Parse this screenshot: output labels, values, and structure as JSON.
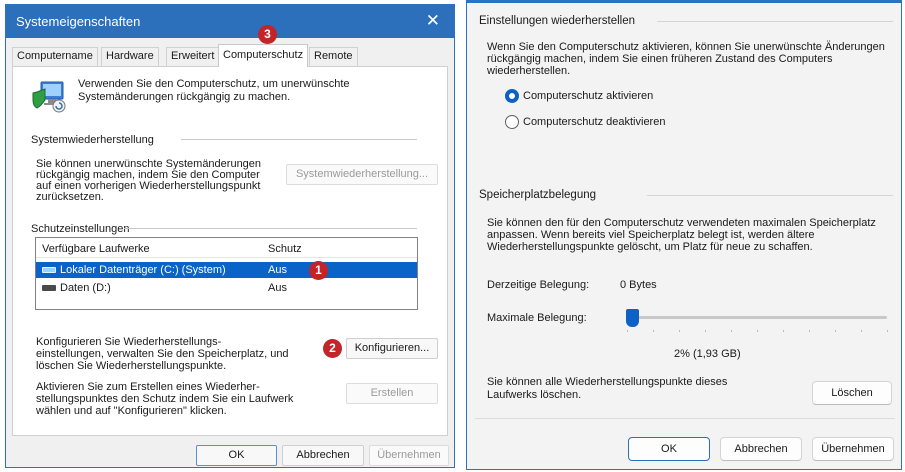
{
  "left": {
    "title": "Systemeigenschaften",
    "close_glyph": "✕",
    "tabs": [
      "Computername",
      "Hardware",
      "Erweitert",
      "Computerschutz",
      "Remote"
    ],
    "intro_line1": "Verwenden Sie den Computerschutz, um unerwünschte",
    "intro_line2": "Systemänderungen rückgängig zu machen.",
    "restore_heading": "Systemwiederherstellung",
    "restore_text": [
      "Sie können unerwünschte Systemänderungen",
      "rückgängig machen, indem Sie den Computer",
      "auf einen vorherigen Wiederherstellungspunkt",
      "zurücksetzen."
    ],
    "restore_button": "Systemwiederherstellung...",
    "protection_heading": "Schutzeinstellungen",
    "columns": [
      "Verfügbare Laufwerke",
      "Schutz"
    ],
    "drives": [
      {
        "name": "Lokaler Datenträger (C:) (System)",
        "protection": "Aus"
      },
      {
        "name": "Daten (D:)",
        "protection": "Aus"
      }
    ],
    "configure_text": [
      "Konfigurieren Sie Wiederherstellungs-",
      "einstellungen, verwalten Sie den Speicherplatz, und",
      "löschen Sie Wiederherstellungspunkte."
    ],
    "configure_button": "Konfigurieren...",
    "create_text": [
      "Aktivieren Sie zum Erstellen eines Wiederher-",
      "stellungspunktes den Schutz indem Sie ein Laufwerk",
      "wählen und auf \"Konfigurieren\" klicken."
    ],
    "create_button": "Erstellen",
    "ok": "OK",
    "cancel": "Abbrechen",
    "apply": "Übernehmen",
    "badges": [
      "1",
      "2",
      "3"
    ]
  },
  "right": {
    "restore_heading": "Einstellungen wiederherstellen",
    "restore_text": [
      "Wenn Sie den Computerschutz aktivieren, können Sie unerwünschte Änderungen",
      "rückgängig machen, indem Sie einen früheren Zustand des Computers",
      "wiederherstellen."
    ],
    "radio_on": "Computerschutz aktivieren",
    "radio_off": "Computerschutz deaktivieren",
    "disk_heading": "Speicherplatzbelegung",
    "disk_text": [
      "Sie können den für den Computerschutz verwendeten maximalen Speicherplatz",
      "anpassen. Wenn bereits viel Speicherplatz belegt ist, werden ältere",
      "Wiederherstellungspunkte gelöscht, um Platz für neue zu schaffen."
    ],
    "current_label": "Derzeitige Belegung:",
    "current_value": "0 Bytes",
    "max_label": "Maximale Belegung:",
    "slider_value": "2% (1,93 GB)",
    "slider_fraction": 0.02,
    "delete_text": [
      "Sie können alle Wiederherstellungspunkte dieses",
      "Laufwerks löschen."
    ],
    "delete_button": "Löschen",
    "ok": "OK",
    "cancel": "Abbrechen",
    "apply": "Übernehmen"
  },
  "colors": {
    "titlebar": "#2c6fba",
    "selection": "#0a63c7",
    "badge": "#c3242a",
    "accent": "#0b62c4"
  }
}
